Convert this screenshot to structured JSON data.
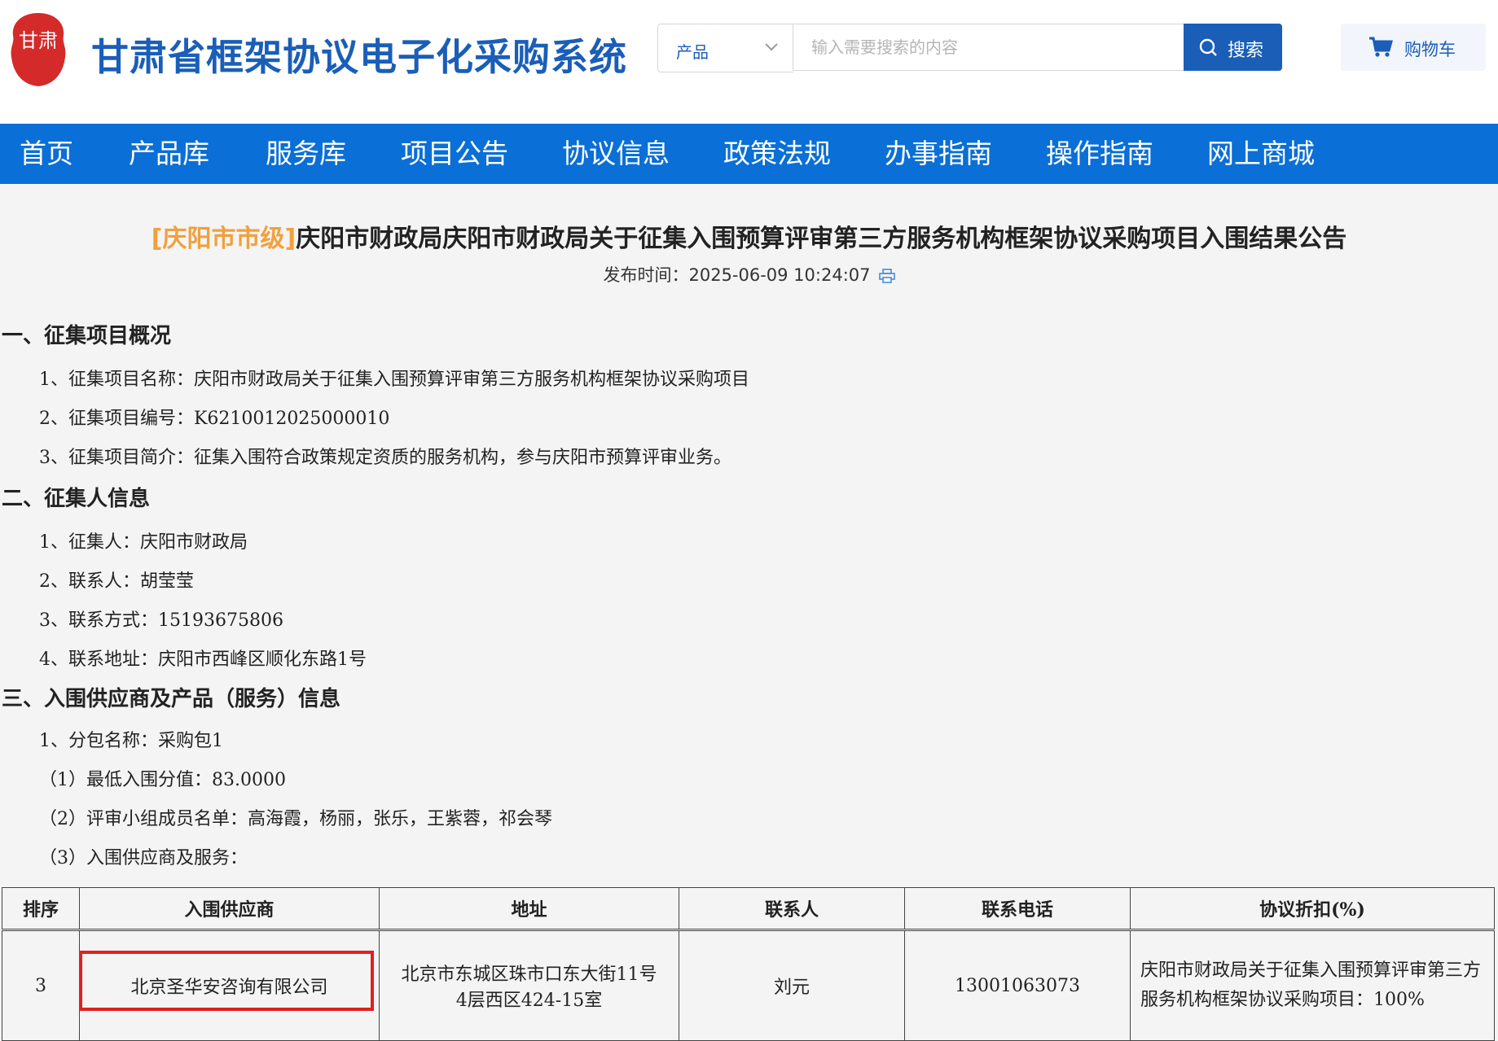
{
  "header": {
    "logo_text": "甘肃",
    "site_title": "甘肃省框架协议电子化采购系统",
    "search": {
      "category": "产品",
      "placeholder": "输入需要搜索的内容",
      "button_label": "搜索"
    },
    "cart_label": "购物车"
  },
  "nav": {
    "items": [
      "首页",
      "产品库",
      "服务库",
      "项目公告",
      "协议信息",
      "政策法规",
      "办事指南",
      "操作指南",
      "网上商城"
    ]
  },
  "notice": {
    "region": "[庆阳市市级]",
    "title": "庆阳市财政局庆阳市财政局关于征集入围预算评审第三方服务机构框架协议采购项目入围结果公告",
    "publish_label": "发布时间：",
    "publish_time": "2025-06-09 10:24:07"
  },
  "sections": {
    "s1": {
      "heading": "一、征集项目概况",
      "lines": [
        "1、征集项目名称：庆阳市财政局关于征集入围预算评审第三方服务机构框架协议采购项目",
        "2、征集项目编号：K6210012025000010",
        "3、征集项目简介：征集入围符合政策规定资质的服务机构，参与庆阳市预算评审业务。"
      ]
    },
    "s2": {
      "heading": "二、征集人信息",
      "lines": [
        "1、征集人：庆阳市财政局",
        "2、联系人：胡莹莹",
        "3、联系方式：15193675806",
        "4、联系地址：庆阳市西峰区顺化东路1号"
      ]
    },
    "s3": {
      "heading": "三、入围供应商及产品（服务）信息",
      "lines": [
        "1、分包名称：采购包1",
        "（1）最低入围分值：83.0000",
        "（2）评审小组成员名单：高海霞，杨丽，张乐，王紫蓉，祁会琴",
        "（3）入围供应商及服务："
      ]
    }
  },
  "table": {
    "headers": [
      "排序",
      "入围供应商",
      "地址",
      "联系人",
      "联系电话",
      "协议折扣(%)"
    ],
    "rows": [
      {
        "rank": "3",
        "supplier": "北京圣华安咨询有限公司",
        "address_line1": "北京市东城区珠市口东大街11号",
        "address_line2": "4层西区424-15室",
        "contact": "刘元",
        "phone": "13001063073",
        "discount": "庆阳市财政局关于征集入围预算评审第三方服务机构框架协议采购项目：100%"
      }
    ]
  },
  "colors": {
    "brand_blue": "#1a5eb8",
    "nav_blue": "#0a6fd6",
    "region_orange": "#f2a03d",
    "seal_red": "#d42a2a",
    "highlight_red": "#e02020"
  },
  "icons": [
    "seal-logo",
    "chevron-down-icon",
    "search-icon",
    "cart-icon",
    "print-icon"
  ]
}
